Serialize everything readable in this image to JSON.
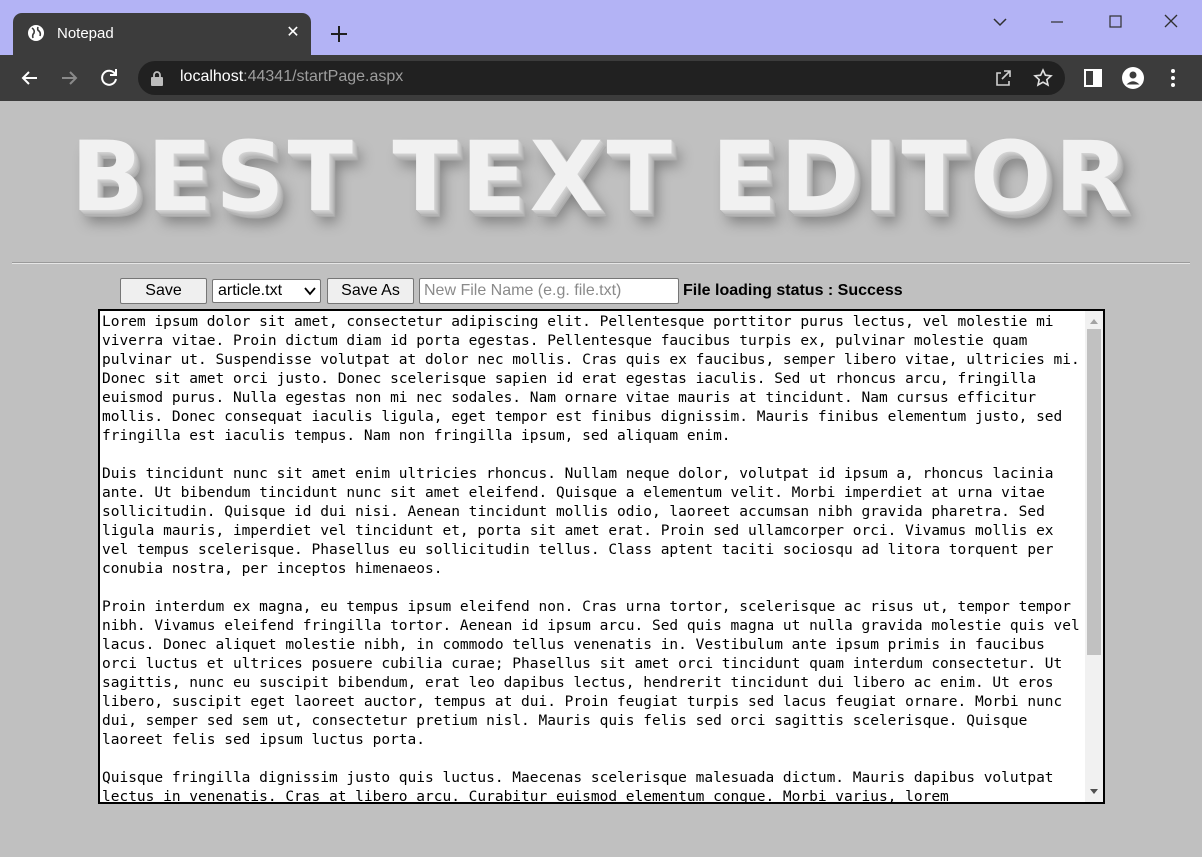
{
  "browser": {
    "tab_title": "Notepad",
    "url_host": "localhost",
    "url_rest": ":44341/startPage.aspx"
  },
  "page": {
    "banner_text": "BEST TEXT EDITOR",
    "save_label": "Save",
    "file_select_value": "article.txt",
    "save_as_label": "Save As",
    "new_file_placeholder": "New File Name (e.g. file.txt)",
    "status_text": "File loading status : Success",
    "editor_paragraphs": [
      "Lorem ipsum dolor sit amet, consectetur adipiscing elit. Pellentesque porttitor purus lectus, vel molestie mi viverra vitae. Proin dictum diam id porta egestas. Pellentesque faucibus turpis ex, pulvinar molestie quam pulvinar ut. Suspendisse volutpat at dolor nec mollis. Cras quis ex faucibus, semper libero vitae, ultricies mi. Donec sit amet orci justo. Donec scelerisque sapien id erat egestas iaculis. Sed ut rhoncus arcu, fringilla euismod purus. Nulla egestas non mi nec sodales. Nam ornare vitae mauris at tincidunt. Nam cursus efficitur mollis. Donec consequat iaculis ligula, eget tempor est finibus dignissim. Mauris finibus elementum justo, sed fringilla est iaculis tempus. Nam non fringilla ipsum, sed aliquam enim.",
      "Duis tincidunt nunc sit amet enim ultricies rhoncus. Nullam neque dolor, volutpat id ipsum a, rhoncus lacinia ante. Ut bibendum tincidunt nunc sit amet eleifend. Quisque a elementum velit. Morbi imperdiet at urna vitae sollicitudin. Quisque id dui nisi. Aenean tincidunt mollis odio, laoreet accumsan nibh gravida pharetra. Sed ligula mauris, imperdiet vel tincidunt et, porta sit amet erat. Proin sed ullamcorper orci. Vivamus mollis ex vel tempus scelerisque. Phasellus eu sollicitudin tellus. Class aptent taciti sociosqu ad litora torquent per conubia nostra, per inceptos himenaeos.",
      "Proin interdum ex magna, eu tempus ipsum eleifend non. Cras urna tortor, scelerisque ac risus ut, tempor tempor nibh. Vivamus eleifend fringilla tortor. Aenean id ipsum arcu. Sed quis magna ut nulla gravida molestie quis vel lacus. Donec aliquet molestie nibh, in commodo tellus venenatis in. Vestibulum ante ipsum primis in faucibus orci luctus et ultrices posuere cubilia curae; Phasellus sit amet orci tincidunt quam interdum consectetur. Ut sagittis, nunc eu suscipit bibendum, erat leo dapibus lectus, hendrerit tincidunt dui libero ac enim. Ut eros libero, suscipit eget laoreet auctor, tempus at dui. Proin feugiat turpis sed lacus feugiat ornare. Morbi nunc dui, semper sed sem ut, consectetur pretium nisl. Mauris quis felis sed orci sagittis scelerisque. Quisque laoreet felis sed ipsum luctus porta.",
      "Quisque fringilla dignissim justo quis luctus. Maecenas scelerisque malesuada dictum. Mauris dapibus volutpat lectus in venenatis. Cras at libero arcu. Curabitur euismod elementum congue. Morbi varius, lorem"
    ]
  }
}
